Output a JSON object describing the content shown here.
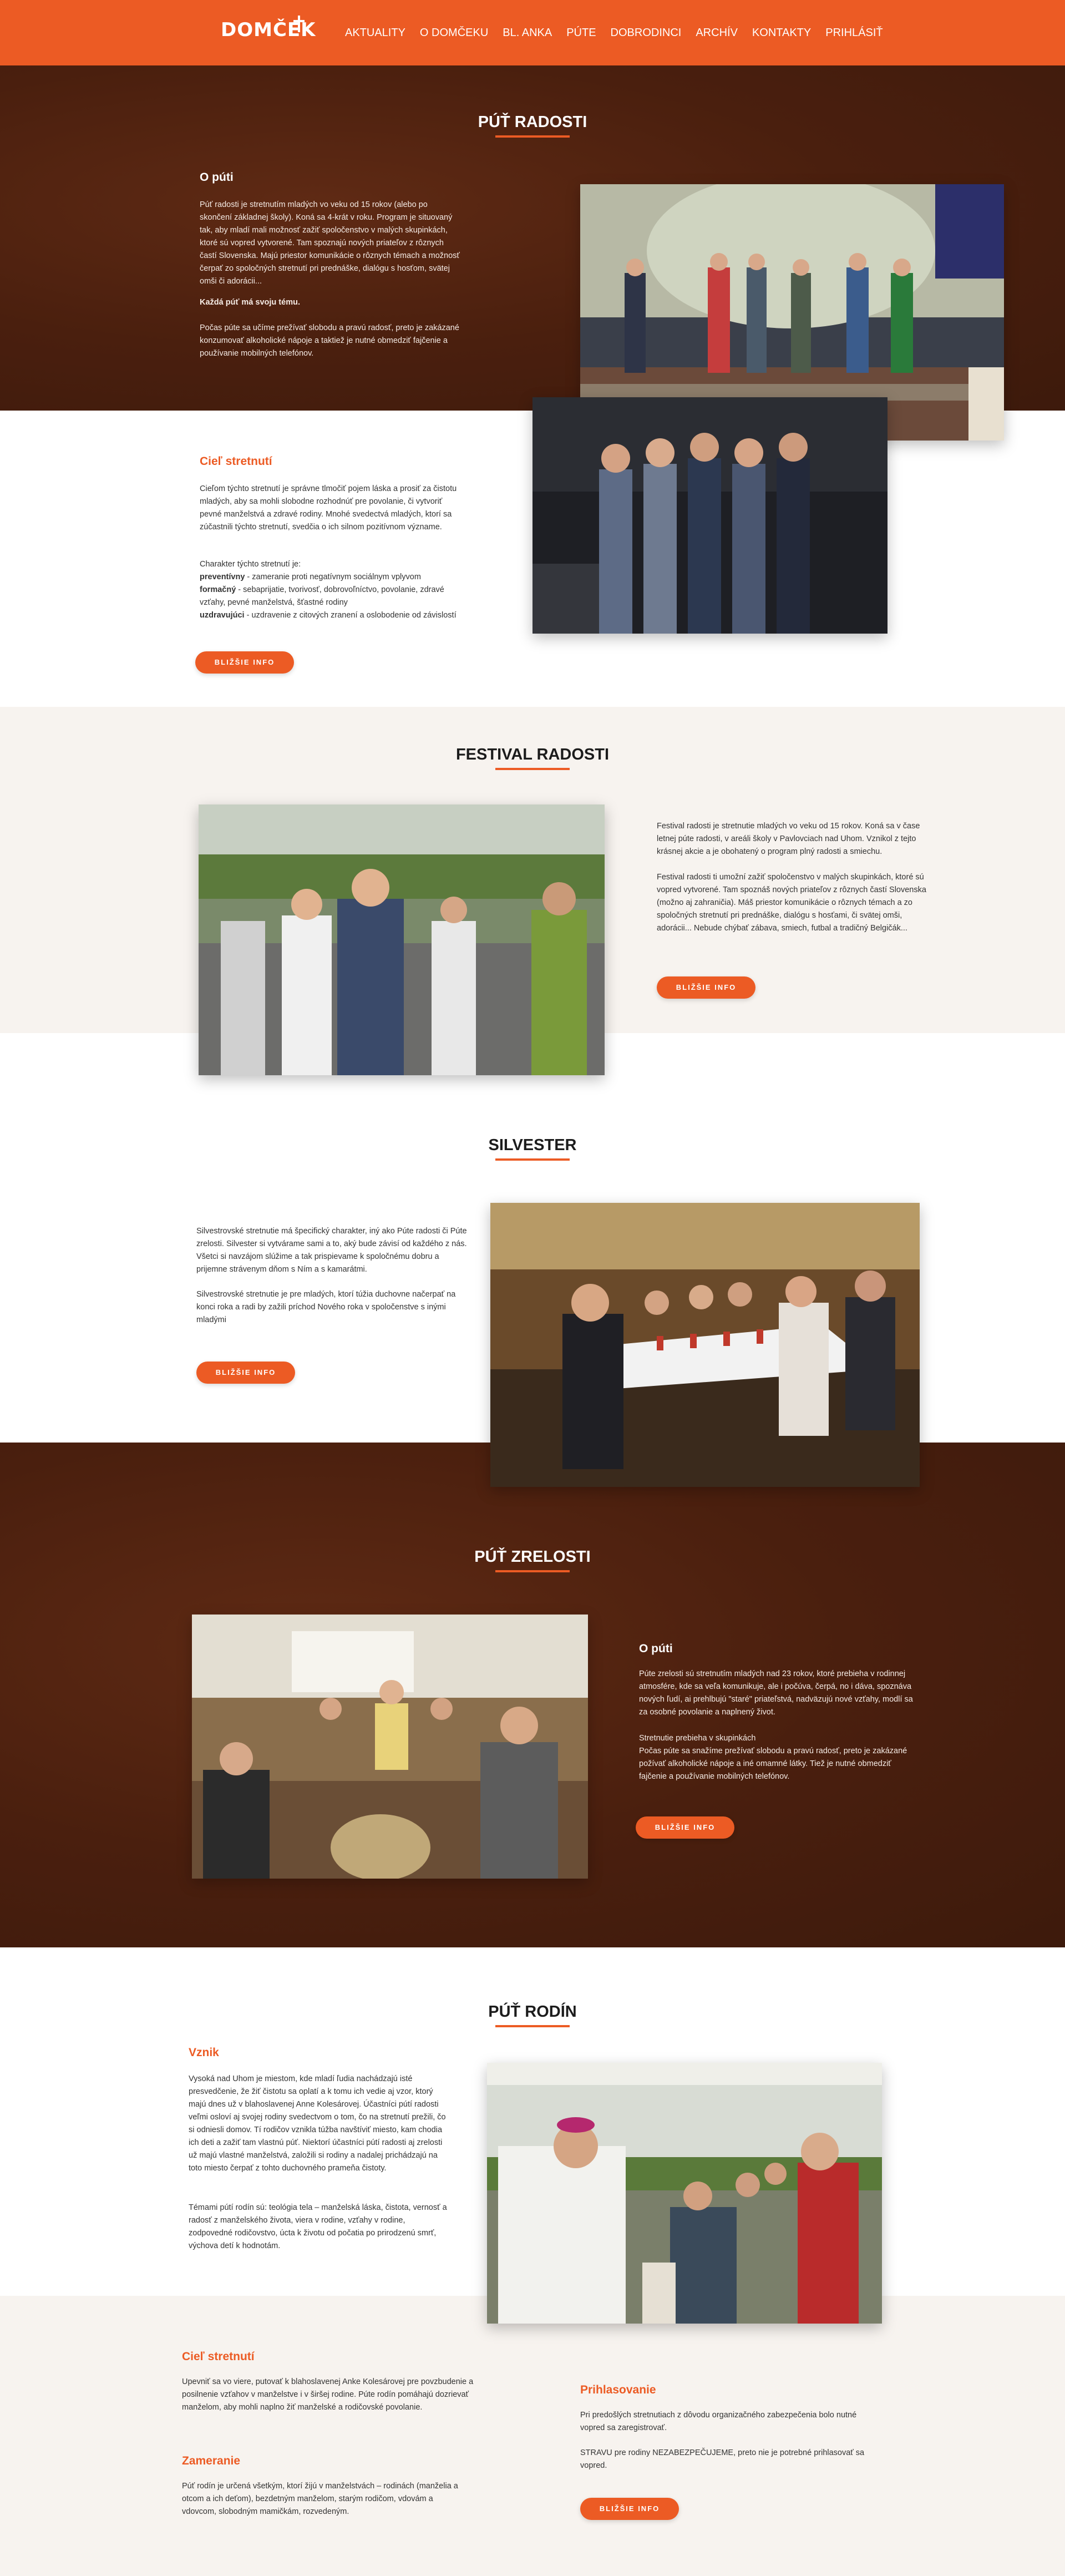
{
  "nav": {
    "logo": "DOMČEK",
    "items": [
      "AKTUALITY",
      "O DOMČEKU",
      "BL. ANKA",
      "PÚTE",
      "DOBRODINCI",
      "ARCHÍV",
      "KONTAKTY",
      "PRIHLÁSIŤ"
    ]
  },
  "pute_radosti": {
    "title": "PÚŤ RADOSTI",
    "about_title": "O púti",
    "about_text": "Púť radosti je stretnutím mladých vo veku od 15 rokov (alebo po skončení základnej školy). Koná sa 4-krát v roku. Program je situovaný tak, aby mladí mali možnosť zažiť spoločenstvo v malých skupinkách, ktoré sú vopred vytvorené. Tam spoznajú nových priateľov z rôznych častí Slovenska. Majú priestor komunikácie o rôznych témach a možnosť čerpať zo spoločných stretnutí pri prednáške, dialógu s hosťom, svätej omši či adorácii...",
    "about_bold": "Každá púť má svoju tému.",
    "about_text2": "Počas púte sa učíme prežívať slobodu a pravú radosť, preto je zakázané konzumovať alkoholické nápoje a taktiež je nutné obmedziť fajčenie a používanie mobilných telefónov.",
    "goal_title": "Cieľ stretnutí",
    "goal_text": "Cieľom týchto stretnutí je správne tlmočiť pojem láska a prosiť za čistotu mladých, aby sa mohli slobodne rozhodnúť pre povolanie, či vytvoriť pevné manželstvá a zdravé rodiny. Mnohé svedectvá mladých, ktorí sa zúčastnili týchto stretnutí, svedčia o ich silnom pozitívnom význame.",
    "char_intro": "Charakter týchto stretnutí je:",
    "char_items": [
      {
        "term": "preventívny",
        "desc": " - zameranie proti negatívnym sociálnym vplyvom"
      },
      {
        "term": "formačný",
        "desc": " - sebaprijatie, tvorivosť, dobrovoľníctvo, povolanie, zdravé vzťahy, pevné manželstvá, šťastné rodiny"
      },
      {
        "term": "uzdravujúci",
        "desc": " - uzdravenie z citových zranení a oslobodenie od závislostí"
      }
    ],
    "button": "BLIŽŠIE INFO"
  },
  "festival": {
    "title": "FESTIVAL RADOSTI",
    "text1": "Festival radosti je stretnutie mladých vo veku od 15 rokov. Koná sa v čase letnej púte radosti, v areáli školy v Pavlovciach nad Uhom. Vznikol z tejto krásnej akcie a je obohatený o program plný radosti a smiechu.",
    "text2": "Festival radosti ti umožní zažiť spoločenstvo v malých skupinkách, ktoré sú vopred vytvorené. Tam spoznáš nových priateľov z rôznych častí Slovenska (možno aj zahraničia). Máš priestor komunikácie o rôznych témach a zo spoločných stretnutí pri prednáške, dialógu s hosťami, či svätej omši, adorácii... Nebude chýbať zábava, smiech, futbal a tradičný Belgičák...",
    "button": "BLIŽŠIE INFO"
  },
  "silvester": {
    "title": "SILVESTER",
    "text1": "Silvestrovské stretnutie má špecifický charakter, iný ako Púte radosti či Púte zrelosti. Silvester si vytvárame sami a to, aký bude závisí od každého z nás. Všetci si navzájom slúžime a tak prispievame k spoločnému dobru a prijemne strávenym dňom s Ním a s kamarátmi.",
    "text2": "Silvestrovské stretnutie je pre mladých, ktorí túžia duchovne načerpať na konci roka a radi by zažili príchod Nového roka v spoločenstve s inými mladými",
    "button": "BLIŽŠIE INFO"
  },
  "zrelost": {
    "title": "PÚŤ ZRELOSTI",
    "about_title": "O púti",
    "text1": "Púte zrelosti sú stretnutím mladých nad 23 rokov, ktoré prebieha v rodinnej atmosfére, kde sa veľa komunikuje, ale i počúva, čerpá, no i dáva, spoznáva nových ľudí, ai prehlbujú \"staré\" priateľstvá, nadväzujú nové vzťahy, modlí sa za osobné povolanie a naplnený život.",
    "text2": "Stretnutie prebieha v skupinkách\nPočas púte sa snažíme prežívať slobodu a pravú radosť, preto je zakázané požívať alkoholické nápoje a iné omamné látky. Tiež je nutné obmedziť fajčenie a používanie mobilných telefónov.",
    "button": "BLIŽŠIE INFO"
  },
  "rodin": {
    "title": "PÚŤ RODÍN",
    "origin_title": "Vznik",
    "origin_text": "Vysoká nad Uhom je miestom, kde mladí ľudia nachádzajú isté presvedčenie, že žiť čistotu sa oplatí a k tomu ich vedie aj vzor, ktorý majú dnes už v blahoslavenej Anne Kolesárovej. Účastníci pútí radosti veľmi osloví aj svojej rodiny svedectvom o tom, čo na stretnutí prežili, čo si odniesli domov. Tí rodičov vznikla túžba navštíviť miesto, kam chodia ich deti a zažiť tam vlastnú púť. Niektorí účastníci pútí radosti aj zrelosti už majú vlastné manželstvá, založili si rodiny a nadalej prichádzajú na toto miesto čerpať z tohto duchovného prameňa čistoty.",
    "topics_text": "Témami pútí rodín sú: teológia tela – manželská láska, čistota, vernosť a radosť z manželského života, viera v rodine, vzťahy v rodine, zodpovedné rodičovstvo, úcta k životu od počatia po prirodzenú smrť, výchova detí k hodnotám.",
    "goal_title": "Cieľ stretnutí",
    "goal_text": "Upevniť sa vo viere, putovať k blahoslavenej Anke Kolesárovej pre povzbudenie a posilnenie vzťahov v manželstve i v širšej rodine. Púte rodín pomáhajú dozrievať manželom, aby mohli naplno žiť manželské a rodičovské povolanie.",
    "focus_title": "Zameranie",
    "focus_text": "Púť rodín je určená všetkým, ktorí žijú v manželstvách – rodinách (manželia a otcom a ich deťom), bezdetným manželom, starým rodičom, vdovám a vdovcom, slobodným mamičkám, rozvedeným.",
    "reg_title": "Prihlasovanie",
    "reg_text1": "Pri predošlých stretnutiach z dôvodu organizačného zabezpečenia bolo nutné vopred sa zaregistrovať.",
    "reg_text2": "STRAVU pre rodiny NEZABEZPEČUJEME, preto nie je potrebné prihlasovať sa vopred.",
    "button": "BLIŽŠIE INFO"
  },
  "colors": {
    "accent": "#ec5b24",
    "brown": "#4a1f0e",
    "beige": "#f7f3ef"
  }
}
